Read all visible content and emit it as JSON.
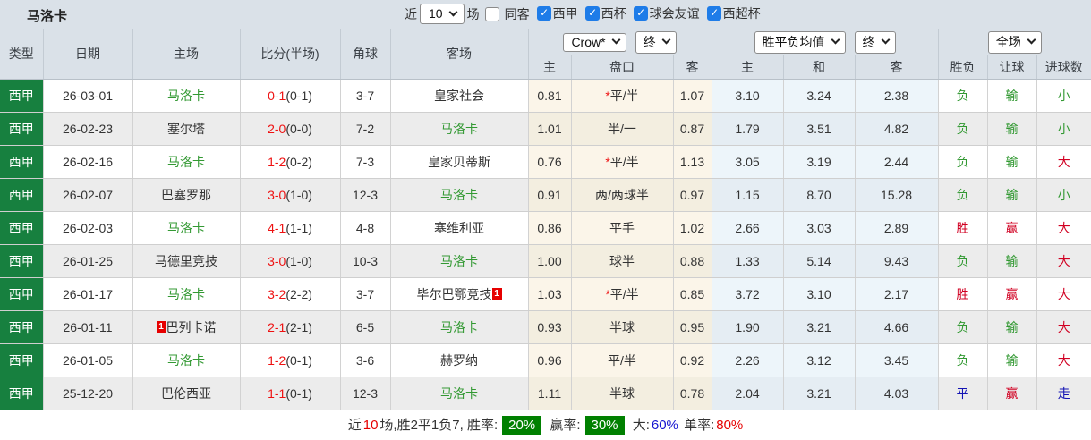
{
  "title": "马洛卡",
  "filters": {
    "recent_label": "近",
    "count_value": "10",
    "matches_label": "场",
    "same_away_label": "同客",
    "same_away_checked": false,
    "leagues": [
      {
        "label": "西甲",
        "checked": true
      },
      {
        "label": "西杯",
        "checked": true
      },
      {
        "label": "球会友谊",
        "checked": true
      },
      {
        "label": "西超杯",
        "checked": true
      }
    ]
  },
  "selectors": {
    "bookmaker": "Crow*",
    "bookmaker_state": "终",
    "avg_label": "胜平负均值",
    "avg_state": "终",
    "scope": "全场"
  },
  "columns": {
    "type": "类型",
    "date": "日期",
    "home": "主场",
    "score": "比分(半场)",
    "corner": "角球",
    "away": "客场",
    "odds_home": "主",
    "handicap": "盘口",
    "odds_away": "客",
    "avg_home": "主",
    "avg_draw": "和",
    "avg_away": "客",
    "result": "胜负",
    "handicap_result": "让球",
    "goals": "进球数"
  },
  "rows": [
    {
      "league": "西甲",
      "date": "26-03-01",
      "home": {
        "name": "马洛卡",
        "green": true,
        "badge": "",
        "badge_pos": ""
      },
      "score": {
        "full": "0-1",
        "half": "(0-1)"
      },
      "corner": "3-7",
      "away": {
        "name": "皇家社会",
        "green": false,
        "badge": "",
        "badge_pos": ""
      },
      "odds": {
        "home": "0.81",
        "star": true,
        "handicap": "平/半",
        "away": "1.07"
      },
      "avg": {
        "home": "3.10",
        "draw": "3.24",
        "away": "2.38"
      },
      "verdict": {
        "result": "负",
        "result_c": "grn",
        "handicap": "输",
        "handicap_c": "grn",
        "goals": "小",
        "goals_c": "grn"
      }
    },
    {
      "league": "西甲",
      "date": "26-02-23",
      "home": {
        "name": "塞尔塔",
        "green": false,
        "badge": "",
        "badge_pos": ""
      },
      "score": {
        "full": "2-0",
        "half": "(0-0)"
      },
      "corner": "7-2",
      "away": {
        "name": "马洛卡",
        "green": true,
        "badge": "",
        "badge_pos": ""
      },
      "odds": {
        "home": "1.01",
        "star": false,
        "handicap": "半/一",
        "away": "0.87"
      },
      "avg": {
        "home": "1.79",
        "draw": "3.51",
        "away": "4.82"
      },
      "verdict": {
        "result": "负",
        "result_c": "grn",
        "handicap": "输",
        "handicap_c": "grn",
        "goals": "小",
        "goals_c": "grn"
      }
    },
    {
      "league": "西甲",
      "date": "26-02-16",
      "home": {
        "name": "马洛卡",
        "green": true,
        "badge": "",
        "badge_pos": ""
      },
      "score": {
        "full": "1-2",
        "half": "(0-2)"
      },
      "corner": "7-3",
      "away": {
        "name": "皇家贝蒂斯",
        "green": false,
        "badge": "",
        "badge_pos": ""
      },
      "odds": {
        "home": "0.76",
        "star": true,
        "handicap": "平/半",
        "away": "1.13"
      },
      "avg": {
        "home": "3.05",
        "draw": "3.19",
        "away": "2.44"
      },
      "verdict": {
        "result": "负",
        "result_c": "grn",
        "handicap": "输",
        "handicap_c": "grn",
        "goals": "大",
        "goals_c": "red"
      }
    },
    {
      "league": "西甲",
      "date": "26-02-07",
      "home": {
        "name": "巴塞罗那",
        "green": false,
        "badge": "",
        "badge_pos": ""
      },
      "score": {
        "full": "3-0",
        "half": "(1-0)"
      },
      "corner": "12-3",
      "away": {
        "name": "马洛卡",
        "green": true,
        "badge": "",
        "badge_pos": ""
      },
      "odds": {
        "home": "0.91",
        "star": false,
        "handicap": "两/两球半",
        "away": "0.97"
      },
      "avg": {
        "home": "1.15",
        "draw": "8.70",
        "away": "15.28"
      },
      "verdict": {
        "result": "负",
        "result_c": "grn",
        "handicap": "输",
        "handicap_c": "grn",
        "goals": "小",
        "goals_c": "grn"
      }
    },
    {
      "league": "西甲",
      "date": "26-02-03",
      "home": {
        "name": "马洛卡",
        "green": true,
        "badge": "",
        "badge_pos": ""
      },
      "score": {
        "full": "4-1",
        "half": "(1-1)"
      },
      "corner": "4-8",
      "away": {
        "name": "塞维利亚",
        "green": false,
        "badge": "",
        "badge_pos": ""
      },
      "odds": {
        "home": "0.86",
        "star": false,
        "handicap": "平手",
        "away": "1.02"
      },
      "avg": {
        "home": "2.66",
        "draw": "3.03",
        "away": "2.89"
      },
      "verdict": {
        "result": "胜",
        "result_c": "red",
        "handicap": "赢",
        "handicap_c": "red",
        "goals": "大",
        "goals_c": "red"
      }
    },
    {
      "league": "西甲",
      "date": "26-01-25",
      "home": {
        "name": "马德里竞技",
        "green": false,
        "badge": "",
        "badge_pos": ""
      },
      "score": {
        "full": "3-0",
        "half": "(1-0)"
      },
      "corner": "10-3",
      "away": {
        "name": "马洛卡",
        "green": true,
        "badge": "",
        "badge_pos": ""
      },
      "odds": {
        "home": "1.00",
        "star": false,
        "handicap": "球半",
        "away": "0.88"
      },
      "avg": {
        "home": "1.33",
        "draw": "5.14",
        "away": "9.43"
      },
      "verdict": {
        "result": "负",
        "result_c": "grn",
        "handicap": "输",
        "handicap_c": "grn",
        "goals": "大",
        "goals_c": "red"
      }
    },
    {
      "league": "西甲",
      "date": "26-01-17",
      "home": {
        "name": "马洛卡",
        "green": true,
        "badge": "",
        "badge_pos": ""
      },
      "score": {
        "full": "3-2",
        "half": "(2-2)"
      },
      "corner": "3-7",
      "away": {
        "name": "毕尔巴鄂竞技",
        "green": false,
        "badge": "1",
        "badge_pos": "after"
      },
      "odds": {
        "home": "1.03",
        "star": true,
        "handicap": "平/半",
        "away": "0.85"
      },
      "avg": {
        "home": "3.72",
        "draw": "3.10",
        "away": "2.17"
      },
      "verdict": {
        "result": "胜",
        "result_c": "red",
        "handicap": "赢",
        "handicap_c": "red",
        "goals": "大",
        "goals_c": "red"
      }
    },
    {
      "league": "西甲",
      "date": "26-01-11",
      "home": {
        "name": "巴列卡诺",
        "green": false,
        "badge": "1",
        "badge_pos": "before"
      },
      "score": {
        "full": "2-1",
        "half": "(2-1)"
      },
      "corner": "6-5",
      "away": {
        "name": "马洛卡",
        "green": true,
        "badge": "",
        "badge_pos": ""
      },
      "odds": {
        "home": "0.93",
        "star": false,
        "handicap": "半球",
        "away": "0.95"
      },
      "avg": {
        "home": "1.90",
        "draw": "3.21",
        "away": "4.66"
      },
      "verdict": {
        "result": "负",
        "result_c": "grn",
        "handicap": "输",
        "handicap_c": "grn",
        "goals": "大",
        "goals_c": "red"
      }
    },
    {
      "league": "西甲",
      "date": "26-01-05",
      "home": {
        "name": "马洛卡",
        "green": true,
        "badge": "",
        "badge_pos": ""
      },
      "score": {
        "full": "1-2",
        "half": "(0-1)"
      },
      "corner": "3-6",
      "away": {
        "name": "赫罗纳",
        "green": false,
        "badge": "",
        "badge_pos": ""
      },
      "odds": {
        "home": "0.96",
        "star": false,
        "handicap": "平/半",
        "away": "0.92"
      },
      "avg": {
        "home": "2.26",
        "draw": "3.12",
        "away": "3.45"
      },
      "verdict": {
        "result": "负",
        "result_c": "grn",
        "handicap": "输",
        "handicap_c": "grn",
        "goals": "大",
        "goals_c": "red"
      }
    },
    {
      "league": "西甲",
      "date": "25-12-20",
      "home": {
        "name": "巴伦西亚",
        "green": false,
        "badge": "",
        "badge_pos": ""
      },
      "score": {
        "full": "1-1",
        "half": "(0-1)"
      },
      "corner": "12-3",
      "away": {
        "name": "马洛卡",
        "green": true,
        "badge": "",
        "badge_pos": ""
      },
      "odds": {
        "home": "1.11",
        "star": false,
        "handicap": "半球",
        "away": "0.78"
      },
      "avg": {
        "home": "2.04",
        "draw": "3.21",
        "away": "4.03"
      },
      "verdict": {
        "result": "平",
        "result_c": "blu",
        "handicap": "赢",
        "handicap_c": "red",
        "goals": "走",
        "goals_c": "blu"
      }
    }
  ],
  "footer": {
    "segments": [
      {
        "text": "近",
        "style": "plain"
      },
      {
        "text": "10",
        "style": "fred"
      },
      {
        "text": "场,胜2平1负7, 胜率:",
        "style": "plain"
      },
      {
        "text": "20%",
        "style": "greenbox"
      },
      {
        "text": " 赢率:",
        "style": "plain"
      },
      {
        "text": "30%",
        "style": "greenbox"
      },
      {
        "text": " 大:",
        "style": "plain"
      },
      {
        "text": "60%",
        "style": "fblu"
      },
      {
        "text": " 单率:",
        "style": "plain"
      },
      {
        "text": "80%",
        "style": "fred"
      }
    ]
  },
  "colors": {
    "header_bg": "#dae1e8",
    "league_cell_green": "#17803f",
    "team_green": "#339933",
    "result_red": "#d10022",
    "result_blue": "#1414b4",
    "score_red": "#ee1111",
    "checkbox_blue": "#1e7ce8",
    "footer_badge_green": "#008000",
    "odds_col_bg": "#fbf5e9",
    "avg_col_bg": "#edf5fa"
  }
}
